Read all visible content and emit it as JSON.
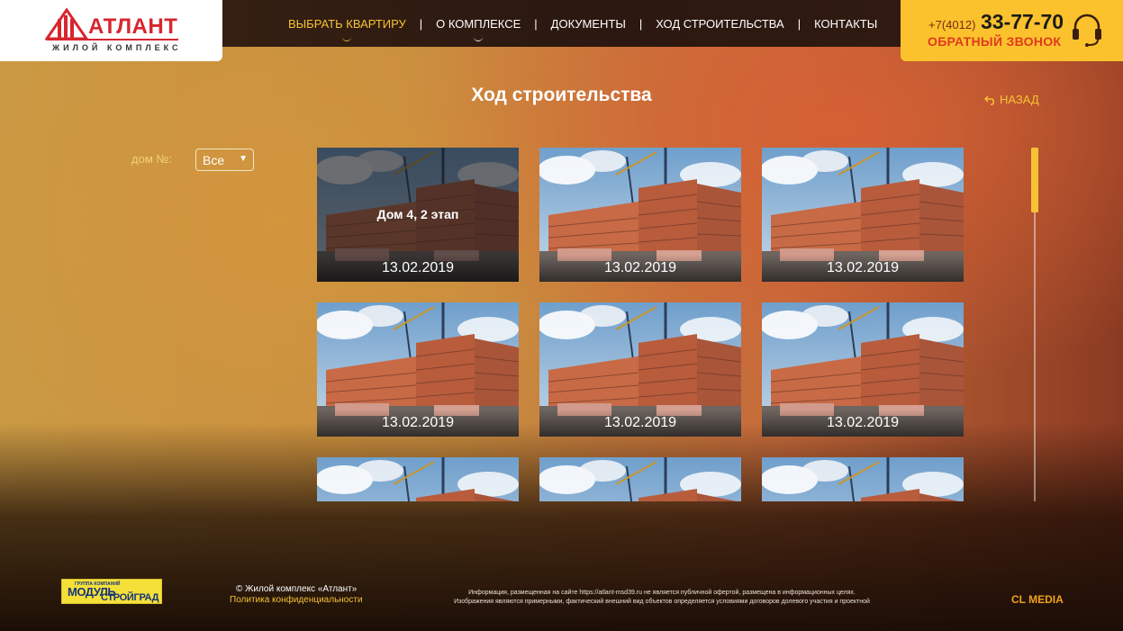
{
  "header": {
    "logo": {
      "title": "АТЛАНТ",
      "subtitle": "ЖИЛОЙ КОМПЛЕКС"
    },
    "nav": [
      {
        "label": "ВЫБРАТЬ КВАРТИРУ",
        "active": true
      },
      {
        "label": "О КОМПЛЕКСЕ",
        "active": false
      },
      {
        "label": "ДОКУМЕНТЫ",
        "active": false
      },
      {
        "label": "ХОД СТРОИТЕЛЬСТВА",
        "active": false
      },
      {
        "label": "КОНТАКТЫ",
        "active": false
      }
    ],
    "phone": {
      "code": "+7(4012)",
      "number": "33-77-70",
      "callback": "ОБРАТНЫЙ ЗВОНОК"
    }
  },
  "page": {
    "title": "Ход строительства",
    "back": "НАЗАД"
  },
  "filter": {
    "label": "дом №:",
    "selected": "Все"
  },
  "cards": [
    {
      "date": "13.02.2019",
      "title": "Дом 4, 2 этап",
      "hovered": true
    },
    {
      "date": "13.02.2019"
    },
    {
      "date": "13.02.2019"
    },
    {
      "date": "13.02.2019"
    },
    {
      "date": "13.02.2019"
    },
    {
      "date": "13.02.2019"
    },
    {
      "date": ""
    },
    {
      "date": ""
    },
    {
      "date": ""
    }
  ],
  "footer": {
    "partner": {
      "small": "ГРУППА КОМПАНИЙ",
      "line1": "МОДУЛЬ",
      "line2": "СТРОЙГРАД"
    },
    "copyright": "© Жилой комплекс «Атлант»",
    "privacy": "Политика конфиденциальности",
    "disclaimer_1": "Информация, размещенная на сайте https://atlant-msd39.ru не является публичной офертой, размещена в информационных целях.",
    "disclaimer_2": "Изображения являются примерными, фактический внешний вид объектов определяется условиями договоров долевого участия и проектной",
    "credit": "CL MEDIA"
  },
  "colors": {
    "accent": "#f7c234",
    "brand_red": "#d7262e",
    "phone_bg": "#fcc22d"
  }
}
